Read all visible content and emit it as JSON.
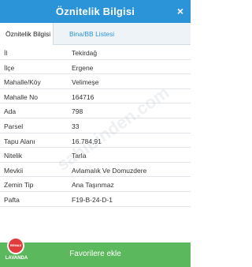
{
  "header": {
    "title": "Öznitelik Bilgisi",
    "close_label": "×"
  },
  "tabs": [
    {
      "label": "Öznitelik Bilgisi",
      "active": true
    },
    {
      "label": "Bina/BB Listesi",
      "active": false
    }
  ],
  "attributes": [
    {
      "label": "İl",
      "value": "Tekirdağ"
    },
    {
      "label": "İlçe",
      "value": "Ergene"
    },
    {
      "label": "Mahalle/Köy",
      "value": "Velimeşe"
    },
    {
      "label": "Mahalle No",
      "value": "164716"
    },
    {
      "label": "Ada",
      "value": "798"
    },
    {
      "label": "Parsel",
      "value": "33"
    },
    {
      "label": "Tapu Alanı",
      "value": "16.784,91"
    },
    {
      "label": "Nitelik",
      "value": "Tarla"
    },
    {
      "label": "Mevkii",
      "value": "Avlamalık Ve Domuzdere"
    },
    {
      "label": "Zemin Tip",
      "value": "Ana Taşınmaz"
    },
    {
      "label": "Pafta",
      "value": "F19-B-24-D-1"
    }
  ],
  "watermark": "sahibinden.com",
  "footer": {
    "favorite_label": "Favorilere ekle"
  },
  "logo": {
    "brand": "REMAX",
    "name": "LAVANDA",
    "color": "#e23b3b"
  },
  "colors": {
    "header": "#2b93d8",
    "footer": "#5cb85c"
  }
}
